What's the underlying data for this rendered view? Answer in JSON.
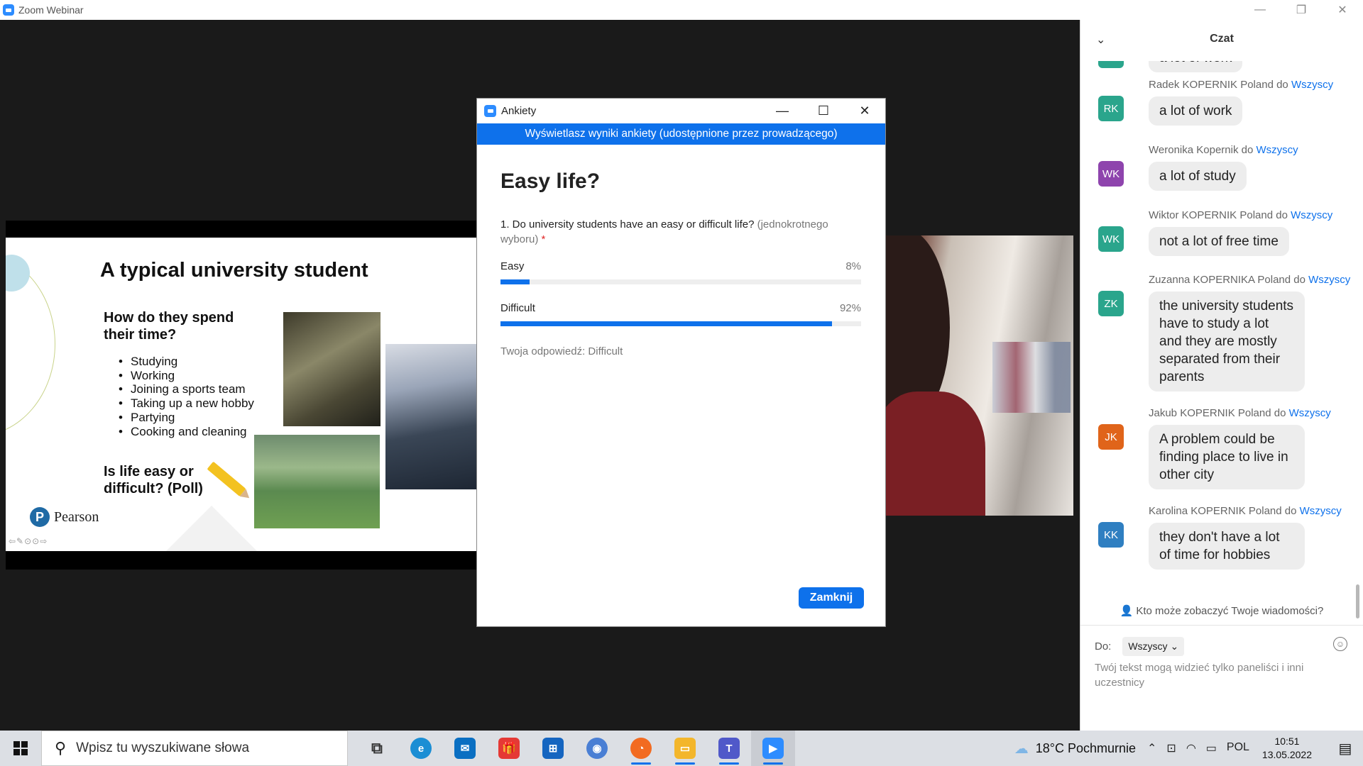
{
  "window": {
    "title": "Zoom Webinar",
    "controls": [
      "—",
      "❐",
      "✕"
    ]
  },
  "slide": {
    "title": "A typical university student",
    "subtitle": "How do they spend their time?",
    "bullets": [
      "Studying",
      "Working",
      "Joining a sports team",
      "Taking up a new hobby",
      "Partying",
      "Cooking and cleaning"
    ],
    "question": "Is life easy or difficult? (Poll)",
    "brand": "Pearson",
    "brand_logo_letter": "P",
    "nav_controls": "⇦✎⊙⊙⇨"
  },
  "poll": {
    "window_title": "Ankiety",
    "banner": "Wyświetlasz wyniki ankiety (udostępnione przez prowadzącego)",
    "title": "Easy life?",
    "question": "1. Do university students have an easy or difficult life?",
    "question_type": "(jednokrotnego wyboru)",
    "required_mark": "*",
    "options": [
      {
        "label": "Easy",
        "percent_label": "8%",
        "percent": 8
      },
      {
        "label": "Difficult",
        "percent_label": "92%",
        "percent": 92
      }
    ],
    "your_answer": "Twoja odpowiedź: Difficult",
    "close_label": "Zamknij",
    "accent": "#0e71eb"
  },
  "chat": {
    "title": "Czat",
    "messages": [
      {
        "sender": "",
        "to": "",
        "initials": "MP",
        "color": "#2aa58c",
        "text": "a lot of work"
      },
      {
        "sender": "Radek KOPERNIK Poland do",
        "to": "Wszyscy",
        "initials": "RK",
        "color": "#2aa58c",
        "text": "a lot of work"
      },
      {
        "sender": "Weronika Kopernik do",
        "to": "Wszyscy",
        "initials": "WK",
        "color": "#8e44ad",
        "text": "a lot of study"
      },
      {
        "sender": "Wiktor KOPERNIK Poland do",
        "to": "Wszyscy",
        "initials": "WK",
        "color": "#2aa58c",
        "text": "not a lot of free time"
      },
      {
        "sender": "Zuzanna KOPERNIKA Poland do",
        "to": "Wszyscy",
        "initials": "ZK",
        "color": "#2aa58c",
        "text": "the university students have to study a lot and they are mostly separated from their parents"
      },
      {
        "sender": "Jakub KOPERNIK Poland do",
        "to": "Wszyscy",
        "initials": "JK",
        "color": "#e0641a",
        "text": "A problem could be finding place to live in other city"
      },
      {
        "sender": "Karolina KOPERNIK Poland do",
        "to": "Wszyscy",
        "initials": "KK",
        "color": "#2f7fc1",
        "text": "they don't have a lot of time for hobbies"
      }
    ],
    "who_sees": "Kto może zobaczyć Twoje wiadomości?",
    "to_label": "Do:",
    "to_value": "Wszyscy",
    "input_placeholder": "Twój tekst mogą widzieć tylko paneliści i inni uczestnicy"
  },
  "taskbar": {
    "search_placeholder": "Wpisz tu wyszukiwane słowa",
    "weather": "18°C Pochmurnie",
    "language": "POL",
    "time": "10:51",
    "date": "13.05.2022",
    "apps": [
      {
        "name": "task-view",
        "glyph": "⧉",
        "color": "#333333"
      },
      {
        "name": "edge",
        "glyph": "e",
        "color": "#1b8ed4"
      },
      {
        "name": "mail",
        "glyph": "✉",
        "color": "#0a6fc2"
      },
      {
        "name": "gift-app",
        "glyph": "🎁",
        "color": "#e53935"
      },
      {
        "name": "store",
        "glyph": "⊞",
        "color": "#1565c0"
      },
      {
        "name": "chrome",
        "glyph": "◉",
        "color": "#4a7fd4"
      },
      {
        "name": "firefox",
        "glyph": "◔",
        "color": "#f26b21"
      },
      {
        "name": "file-explorer",
        "glyph": "▭",
        "color": "#f3b62b"
      },
      {
        "name": "teams",
        "glyph": "T",
        "color": "#5059c9"
      },
      {
        "name": "zoom",
        "glyph": "▶",
        "color": "#2d8cff"
      }
    ]
  }
}
